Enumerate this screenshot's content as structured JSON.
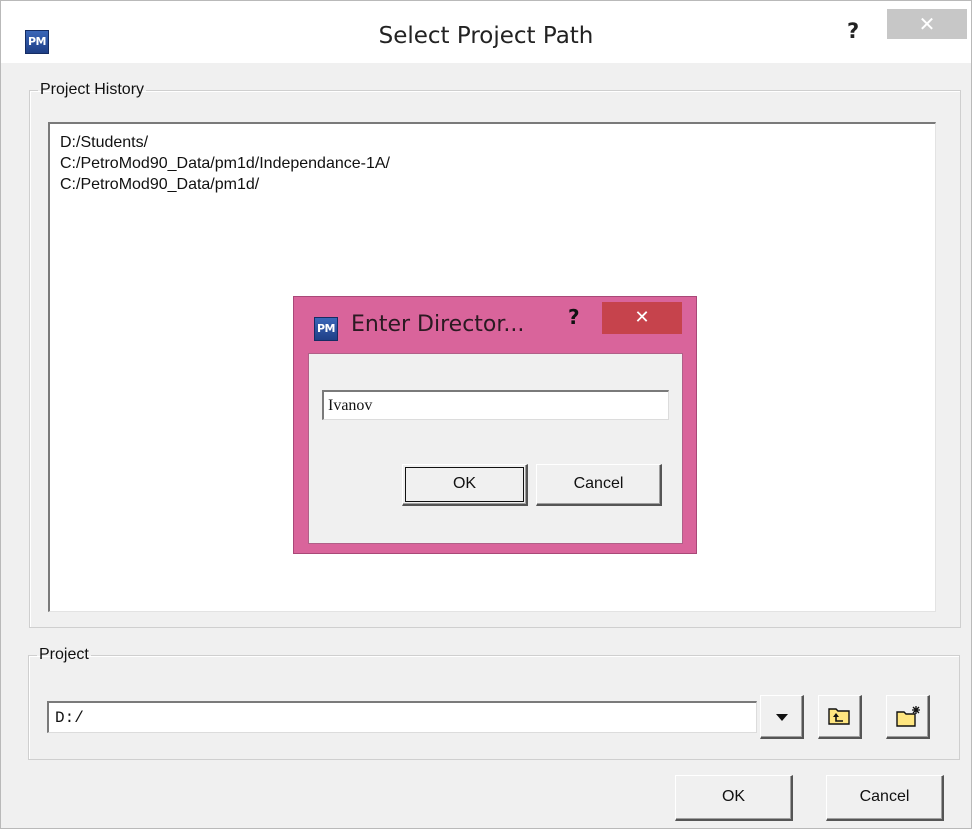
{
  "main_dialog": {
    "app_icon_text": "PM",
    "title": "Select Project Path",
    "help_label": "?",
    "close_label": "✕"
  },
  "history_group": {
    "legend": "Project History",
    "items": [
      "D:/Students/",
      "C:/PetroMod90_Data/pm1d/Independance-1A/",
      "C:/PetroMod90_Data/pm1d/"
    ]
  },
  "project_group": {
    "legend": "Project",
    "path_value": "D:/",
    "dropdown_icon": "chevron-down-icon",
    "up_folder_icon": "folder-up-icon",
    "new_folder_icon": "new-folder-icon"
  },
  "buttons": {
    "ok_label": "OK",
    "cancel_label": "Cancel"
  },
  "sub_dialog": {
    "app_icon_text": "PM",
    "title": "Enter Director...",
    "help_label": "?",
    "close_label": "✕",
    "directory_value": "Ivanov",
    "ok_label": "OK",
    "cancel_label": "Cancel",
    "frame_color": "#d9649b",
    "close_color": "#c6434c"
  }
}
